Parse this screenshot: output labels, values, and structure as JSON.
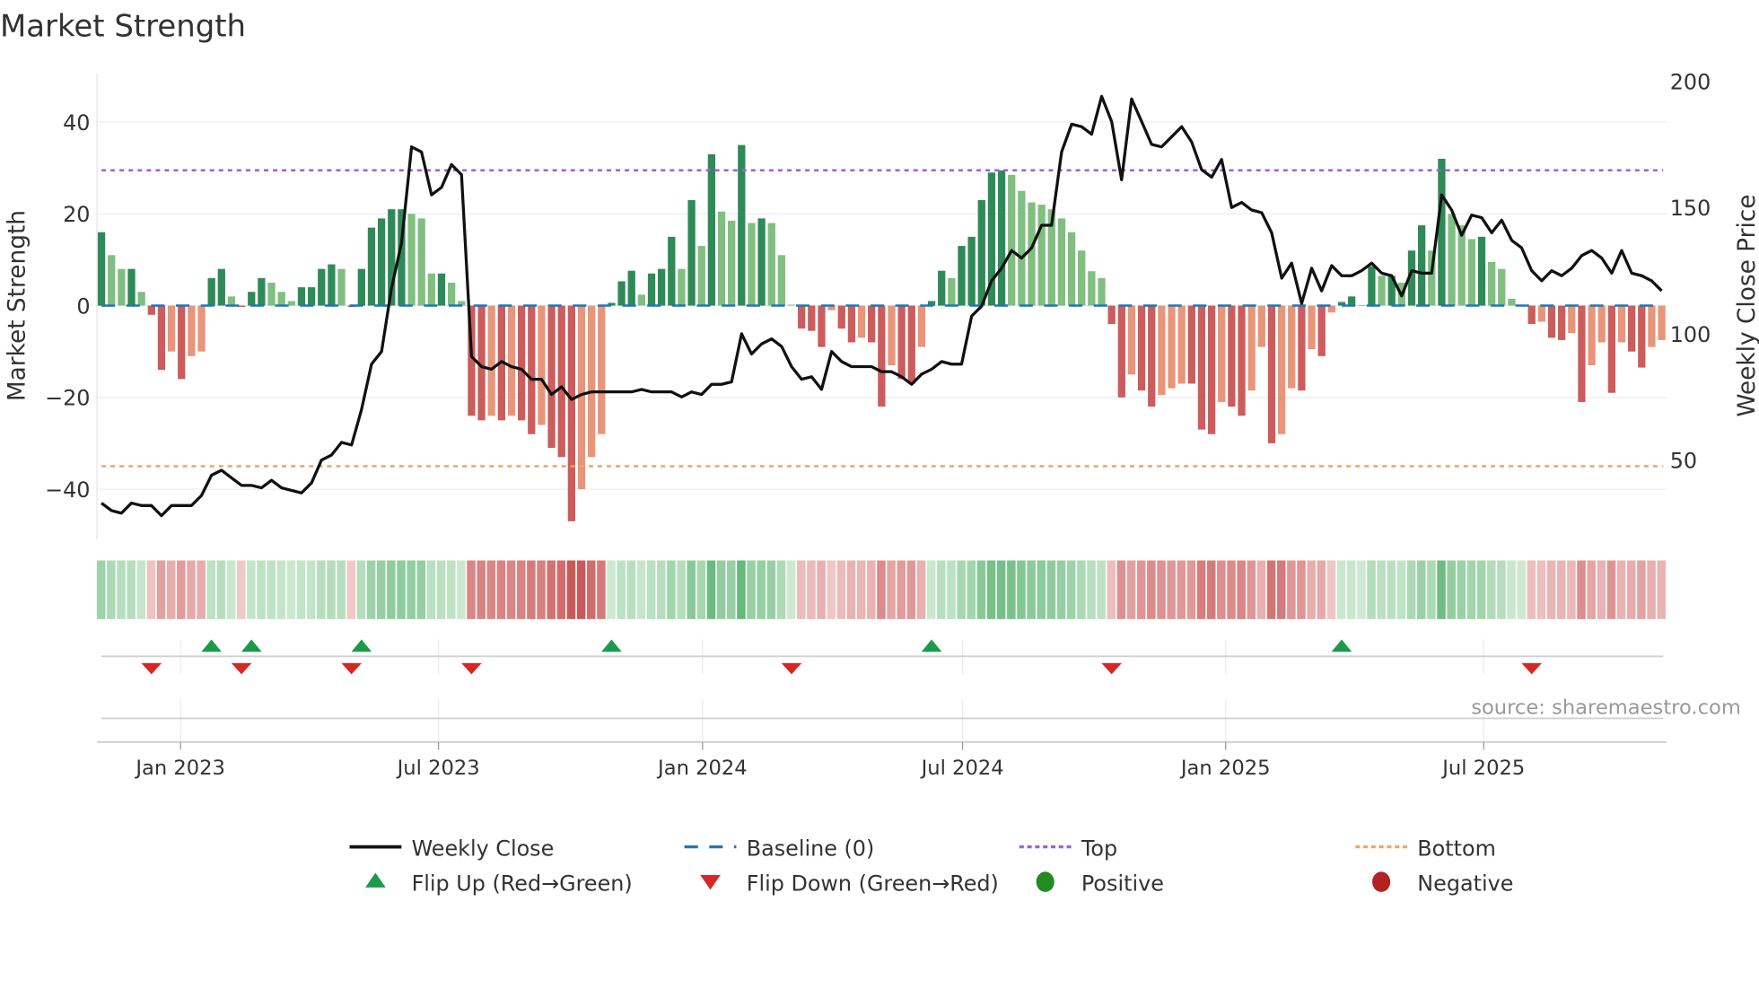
{
  "title": "Market Strength",
  "source": "source: sharemaestro.com",
  "colors": {
    "pos_rising": "#2e8b57",
    "pos_falling": "#80bf80",
    "neg_rising": "#cd5c5c",
    "neg_falling": "#e8957a",
    "price": "#111111",
    "baseline": "#1f77b4",
    "top": "#9c5fd9",
    "bottom": "#f0a465",
    "flip_up": "#1a9a4a",
    "flip_down": "#d62728",
    "positive": "#228b22",
    "negative": "#b22222"
  },
  "legend": [
    {
      "label": "Weekly Close",
      "icon": "solid-line"
    },
    {
      "label": "Baseline (0)",
      "icon": "dashed-line"
    },
    {
      "label": "Top",
      "icon": "dotted-line"
    },
    {
      "label": "Bottom",
      "icon": "dotted-line"
    },
    {
      "label": "Flip Up (Red→Green)",
      "icon": "triangle-up"
    },
    {
      "label": "Flip Down (Green→Red)",
      "icon": "triangle-down"
    },
    {
      "label": "Positive",
      "icon": "circle"
    },
    {
      "label": "Negative",
      "icon": "circle"
    }
  ],
  "chart_data": {
    "type": "bar",
    "title": "Market Strength",
    "ylabel": "Market Strength",
    "y2label": "Weekly Close Price",
    "ylim": [
      -51,
      52
    ],
    "y2lim": [
      20,
      203
    ],
    "yticks": [
      40,
      20,
      0,
      -20,
      -40
    ],
    "yticklabels": [
      "40",
      "20",
      "0",
      "−20",
      "−40"
    ],
    "y2ticks": [
      200,
      150,
      100,
      50
    ],
    "y2ticklabels": [
      "200",
      "150",
      "100",
      "50"
    ],
    "x_unit": "week index",
    "xticks": [
      {
        "label": "Jan 2023",
        "week": 7.9
      },
      {
        "label": "Jul 2023",
        "week": 33.7
      },
      {
        "label": "Jan 2024",
        "week": 60.1
      },
      {
        "label": "Jul 2024",
        "week": 86.1
      },
      {
        "label": "Jan 2025",
        "week": 112.4
      },
      {
        "label": "Jul 2025",
        "week": 138.2
      }
    ],
    "top_level": 29.5,
    "bottom_level": -35,
    "baseline": 0,
    "grid": true,
    "legend_placement": "bottom",
    "strength": [
      16,
      11,
      8,
      8,
      3,
      -2,
      -14,
      -10,
      -16,
      -11,
      -10,
      6,
      8,
      2,
      -0.3,
      3,
      6,
      5,
      3,
      1,
      4,
      4,
      8,
      9,
      8,
      -0.3,
      8,
      17,
      19,
      21,
      21,
      20,
      19,
      7,
      7,
      5,
      1,
      -24,
      -25,
      -24,
      -25,
      -24,
      -25,
      -28,
      -26,
      -31,
      -33,
      -47,
      -40,
      -33,
      -28,
      0.6,
      5.3,
      7.6,
      2.4,
      7,
      8,
      15,
      8,
      23,
      13,
      33,
      20.5,
      18.5,
      35,
      18,
      19,
      18,
      11,
      0.2,
      -5,
      -5.5,
      -9,
      -1,
      -5,
      -8,
      -7,
      -8,
      -22,
      -13,
      -16,
      -17,
      -9,
      1,
      7.6,
      6,
      13,
      15,
      23,
      29,
      29.5,
      28.5,
      25,
      22.5,
      22,
      21,
      19,
      16,
      12,
      7.5,
      6,
      -4,
      -20,
      -15,
      -18.5,
      -22,
      -19.5,
      -18,
      -17,
      -17,
      -27,
      -28,
      -21,
      -22,
      -24,
      -18.5,
      -9,
      -30,
      -28,
      -18,
      -18.5,
      -9.5,
      -11,
      -1.5,
      0.8,
      2,
      0.1,
      8.6,
      6.5,
      6.5,
      5,
      12,
      17.5,
      12,
      32,
      20,
      17.5,
      14.5,
      15,
      9.5,
      8,
      1.5,
      0.1,
      -4,
      -3.5,
      -7,
      -7.5,
      -6,
      -21,
      -13,
      -8,
      -19,
      -8,
      -10,
      -13.5,
      -9,
      -7.5
    ],
    "weekly_close": [
      33,
      30,
      29,
      33,
      32,
      32,
      28,
      32,
      32,
      32,
      36,
      44,
      46,
      43,
      40,
      40,
      39,
      42,
      39,
      38,
      37,
      41,
      50,
      52,
      57,
      56,
      70,
      88,
      93,
      118,
      136,
      174,
      172,
      155,
      158,
      167,
      163,
      91,
      87,
      86,
      89,
      87,
      86,
      82,
      82,
      76,
      79,
      74,
      76,
      77,
      77,
      77,
      77,
      77,
      78,
      77,
      77,
      77,
      75,
      77,
      76,
      80,
      80,
      81,
      100,
      92,
      96,
      98,
      95,
      87,
      82,
      83,
      78,
      93,
      89,
      87,
      87,
      87,
      85,
      85,
      83,
      80,
      84,
      86,
      89,
      88,
      88,
      107,
      111,
      121,
      126,
      133,
      130,
      134,
      143,
      143,
      172,
      183,
      182,
      179,
      194,
      184,
      161,
      193,
      184,
      175,
      174,
      178,
      182,
      176,
      165,
      162,
      169,
      150,
      152,
      149,
      148,
      140,
      122,
      128,
      112,
      126,
      117,
      127,
      123,
      123,
      125,
      128,
      124,
      123,
      115,
      125,
      124,
      124,
      155,
      149,
      139,
      147,
      146,
      140,
      145,
      137,
      134,
      125,
      121,
      125,
      123,
      126,
      131,
      133,
      130,
      124,
      133,
      124,
      123,
      121,
      117
    ],
    "flip_up_weeks": [
      11,
      15,
      26,
      51,
      83,
      124
    ],
    "flip_down_weeks": [
      5,
      14,
      25,
      37,
      69,
      101,
      143
    ]
  }
}
